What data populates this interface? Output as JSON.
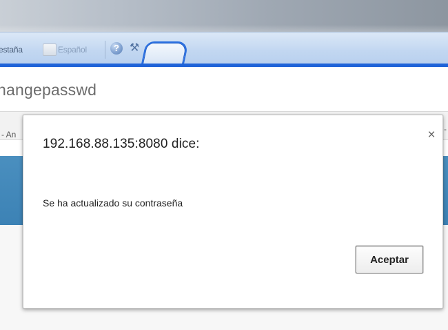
{
  "toolbar": {
    "tab_fragment": "estaña",
    "language_label": "Español",
    "help_icon": "question-circle-icon",
    "tools_icon": "tools-icon",
    "help_glyph": "?",
    "tools_glyph": "⚒"
  },
  "address_bar": {
    "text": "hangepasswd"
  },
  "page": {
    "left_fragment": "- An",
    "right_fragment": "-"
  },
  "dialog": {
    "title": "192.168.88.135:8080 dice:",
    "close_label": "×",
    "message": "Se ha actualizado su contraseña",
    "ok_label": "Aceptar"
  },
  "colors": {
    "tab_accent": "#1f63d8",
    "page_band": "#3c82b5"
  }
}
